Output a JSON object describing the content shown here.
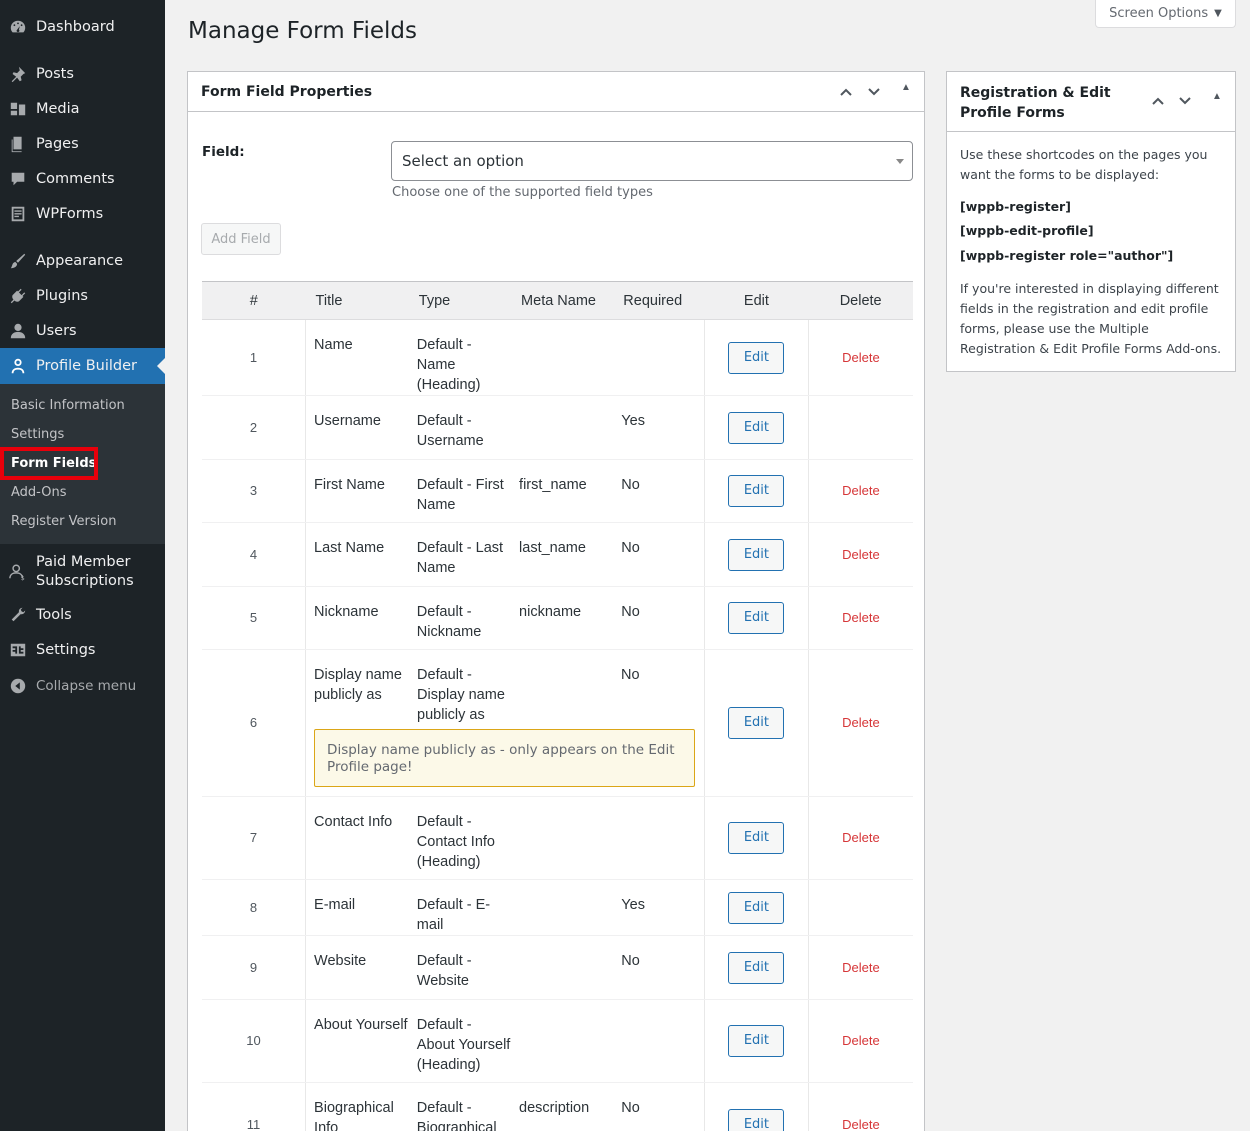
{
  "sidebar": {
    "items": [
      {
        "label": "Dashboard",
        "icon": "dashboard-icon"
      },
      {
        "label": "Posts",
        "icon": "pin-icon"
      },
      {
        "label": "Media",
        "icon": "media-icon"
      },
      {
        "label": "Pages",
        "icon": "pages-icon"
      },
      {
        "label": "Comments",
        "icon": "comment-icon"
      },
      {
        "label": "WPForms",
        "icon": "wpforms-icon"
      },
      {
        "label": "Appearance",
        "icon": "brush-icon"
      },
      {
        "label": "Plugins",
        "icon": "plug-icon"
      },
      {
        "label": "Users",
        "icon": "user-icon"
      },
      {
        "label": "Profile Builder",
        "icon": "profile-icon"
      },
      {
        "label": "Paid Member Subscriptions",
        "icon": "members-icon"
      },
      {
        "label": "Tools",
        "icon": "wrench-icon"
      },
      {
        "label": "Settings",
        "icon": "settings-icon"
      }
    ],
    "submenu": [
      "Basic Information",
      "Settings",
      "Form Fields",
      "Add-Ons",
      "Register Version"
    ],
    "collapse_label": "Collapse menu"
  },
  "header": {
    "title": "Manage Form Fields",
    "screen_options": "Screen Options"
  },
  "main_box": {
    "title": "Form Field Properties",
    "field_label": "Field:",
    "select_value": "Select an option",
    "help_text": "Choose one of the supported field types",
    "add_field_label": "Add Field",
    "columns": [
      "#",
      "Title",
      "Type",
      "Meta Name",
      "Required",
      "Edit",
      "Delete"
    ],
    "edit_label": "Edit",
    "delete_label": "Delete",
    "rows": [
      {
        "num": "1",
        "title": "Name",
        "type": "Default - Name (Heading)",
        "meta": "",
        "required": "",
        "delete": true
      },
      {
        "num": "2",
        "title": "Username",
        "type": "Default - Username",
        "meta": "",
        "required": "Yes",
        "delete": false
      },
      {
        "num": "3",
        "title": "First Name",
        "type": "Default - First Name",
        "meta": "first_name",
        "required": "No",
        "delete": true
      },
      {
        "num": "4",
        "title": "Last Name",
        "type": "Default - Last Name",
        "meta": "last_name",
        "required": "No",
        "delete": true
      },
      {
        "num": "5",
        "title": "Nickname",
        "type": "Default - Nickname",
        "meta": "nickname",
        "required": "No",
        "delete": true
      },
      {
        "num": "6",
        "title": "Display name publicly as",
        "type": "Default - Display name publicly as",
        "meta": "",
        "required": "No",
        "delete": true,
        "notice": "Display name publicly as - only appears on the Edit Profile page!"
      },
      {
        "num": "7",
        "title": "Contact Info",
        "type": "Default - Contact Info (Heading)",
        "meta": "",
        "required": "",
        "delete": true
      },
      {
        "num": "8",
        "title": "E-mail",
        "type": "Default - E-mail",
        "meta": "",
        "required": "Yes",
        "delete": false
      },
      {
        "num": "9",
        "title": "Website",
        "type": "Default - Website",
        "meta": "",
        "required": "No",
        "delete": true
      },
      {
        "num": "10",
        "title": "About Yourself",
        "type": "Default - About Yourself (Heading)",
        "meta": "",
        "required": "",
        "delete": true
      },
      {
        "num": "11",
        "title": "Biographical Info",
        "type": "Default - Biographical Info",
        "meta": "description",
        "required": "No",
        "delete": true
      }
    ]
  },
  "side_box": {
    "title": "Registration & Edit Profile Forms",
    "intro": "Use these shortcodes on the pages you want the forms to be displayed:",
    "shortcodes": [
      "[wppb-register]",
      "[wppb-edit-profile]",
      "[wppb-register role=\"author\"]"
    ],
    "footer": "If you're interested in displaying different fields in the registration and edit profile forms, please use the Multiple Registration & Edit Profile Forms Add-ons."
  },
  "colors": {
    "sidebar_bg": "#1d2327",
    "active": "#2271b1",
    "delete": "#d63638",
    "highlight": "#e8000b"
  }
}
